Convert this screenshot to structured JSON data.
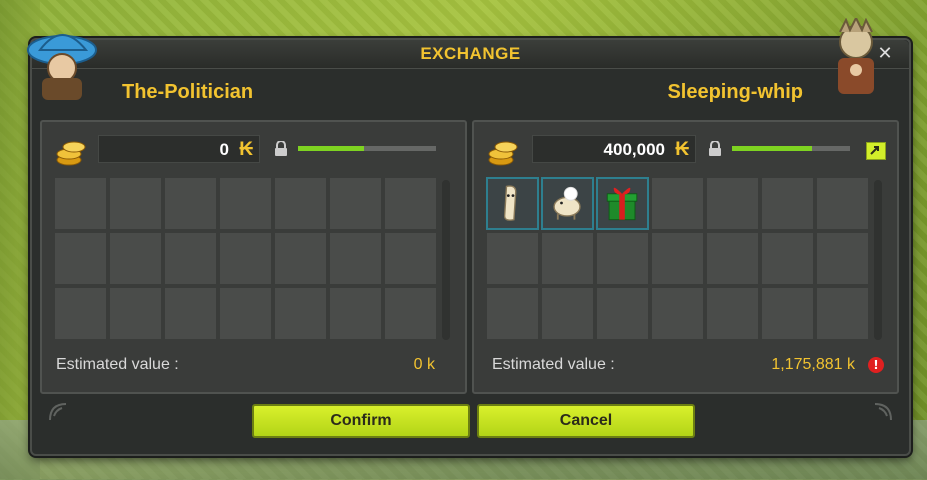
{
  "window": {
    "title": "EXCHANGE",
    "close_glyph": "✕"
  },
  "left_player": {
    "name": "The-Politician",
    "kamas": "0",
    "kamas_glyph": "₭",
    "lock_icon": "lock-icon",
    "progress": 0.48,
    "estimated_label": "Estimated value :",
    "estimated_value": "0 k",
    "items": []
  },
  "right_player": {
    "name": "Sleeping-whip",
    "kamas": "400,000",
    "kamas_glyph": "₭",
    "lock_icon": "lock-icon",
    "progress": 0.68,
    "estimated_label": "Estimated value :",
    "estimated_value": "1,175,881 k",
    "warning_glyph": "!",
    "items": [
      "scroll-item",
      "pet-item",
      "gift-box-item"
    ]
  },
  "buttons": {
    "confirm": "Confirm",
    "cancel": "Cancel"
  },
  "colors": {
    "accent": "#f2c330",
    "button": "#c7e41f",
    "progress": "#7ed321",
    "warning": "#e02020"
  }
}
